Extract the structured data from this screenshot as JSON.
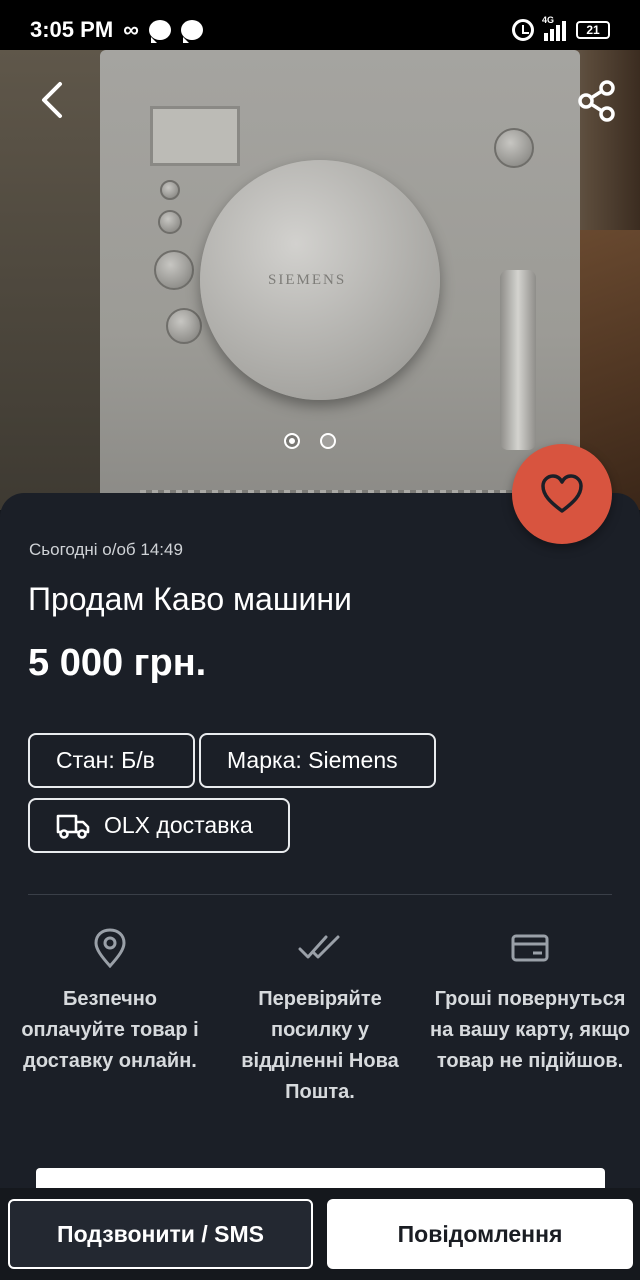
{
  "status_bar": {
    "time": "3:05 PM",
    "network": "4G",
    "battery": "21"
  },
  "photo": {
    "brand_text": "SIEMENS",
    "current_index": 1,
    "total": 2
  },
  "listing": {
    "date": "Сьогодні о/об 14:49",
    "title": "Продам Каво машини",
    "price": "5 000 грн."
  },
  "tags": {
    "condition": "Стан: Б/в",
    "brand": "Марка: Siemens",
    "delivery": "OLX доставка"
  },
  "features": [
    {
      "icon": "location-pin-icon",
      "text": "Безпечно оплачуйте товар і доставку онлайн."
    },
    {
      "icon": "double-check-icon",
      "text": "Перевіряйте посилку у відділенні Нова Пошта."
    },
    {
      "icon": "credit-card-icon",
      "text": "Гроші повернуться на вашу карту, якщо товар не підійшов."
    }
  ],
  "actions": {
    "call": "Подзвонити / SMS",
    "message": "Повідомлення"
  },
  "colors": {
    "accent": "#d8543f",
    "sheet_bg": "#1b1f27",
    "page_bg": "#14171c"
  }
}
